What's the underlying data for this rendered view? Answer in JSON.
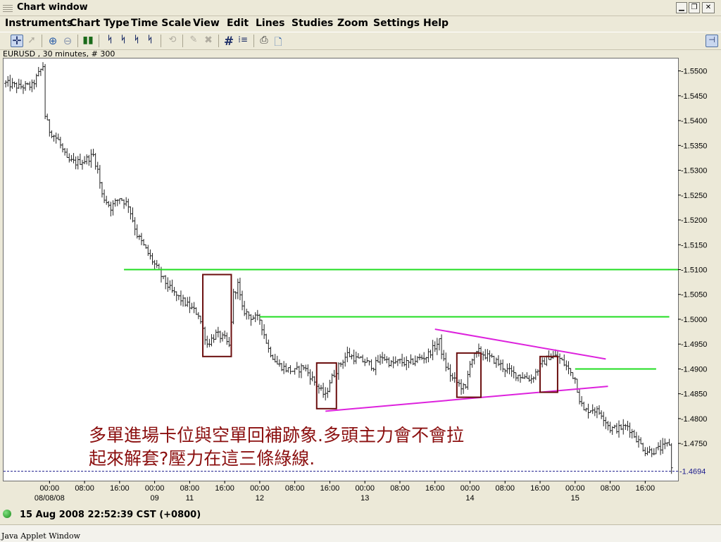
{
  "window": {
    "title": "Chart window",
    "minimize_icon": "minimize-icon",
    "restore_icon": "restore-icon",
    "close_icon": "close-icon"
  },
  "menu": [
    "Instruments",
    "Chart Type",
    "Time Scale",
    "View",
    "Edit",
    "Lines",
    "Studies",
    "Zoom",
    "Settings",
    "Help"
  ],
  "toolbar_icons": [
    "crosshair-icon",
    "pointer-icon",
    "zoom-in-icon",
    "zoom-out-icon",
    "bar-chart-icon",
    "candle-chart-icon",
    "line-chart-icon",
    "ohlc-chart-icon",
    "draw-line-icon",
    "erase-icon",
    "delete-icon",
    "grid-icon",
    "cursor-data-icon",
    "print-icon",
    "print-preview-icon",
    "pin-icon"
  ],
  "symbol_label": "EURUSD , 30 minutes, # 300",
  "status": {
    "datetime": "15 Aug 2008 22:52:39  CST (+0800)",
    "indicator_color": "#2ea82e"
  },
  "applet_label": "Java Applet Window",
  "annotation": {
    "line1": "多單進場卡位與空單回補跡象.多頭主力會不會拉",
    "line2": "起來解套?壓力在這三條綠線."
  },
  "chart_data": {
    "type": "ohlc",
    "symbol": "EURUSD",
    "interval": "30 minutes",
    "bars_count": 300,
    "ylim": [
      1.4675,
      1.5525
    ],
    "yticks": [
      "1.5500",
      "1.5450",
      "1.5400",
      "1.5350",
      "1.5300",
      "1.5250",
      "1.5200",
      "1.5150",
      "1.5100",
      "1.5050",
      "1.5000",
      "1.4950",
      "1.4900",
      "1.4850",
      "1.4800",
      "1.4750"
    ],
    "last_price": "1.4694",
    "x_ticks": [
      {
        "t": 0,
        "time": "00:00",
        "date": "08/08/08"
      },
      {
        "t": 8,
        "time": "08:00",
        "date": ""
      },
      {
        "t": 16,
        "time": "16:00",
        "date": ""
      },
      {
        "t": 24,
        "time": "00:00",
        "date": "09"
      },
      {
        "t": 32,
        "time": "08:00",
        "date": "11"
      },
      {
        "t": 40,
        "time": "16:00",
        "date": ""
      },
      {
        "t": 48,
        "time": "00:00",
        "date": "12"
      },
      {
        "t": 56,
        "time": "08:00",
        "date": ""
      },
      {
        "t": 64,
        "time": "16:00",
        "date": ""
      },
      {
        "t": 72,
        "time": "00:00",
        "date": "13"
      },
      {
        "t": 80,
        "time": "08:00",
        "date": ""
      },
      {
        "t": 88,
        "time": "16:00",
        "date": ""
      },
      {
        "t": 96,
        "time": "00:00",
        "date": "14"
      },
      {
        "t": 104,
        "time": "08:00",
        "date": ""
      },
      {
        "t": 112,
        "time": "16:00",
        "date": ""
      },
      {
        "t": 120,
        "time": "00:00",
        "date": "15"
      },
      {
        "t": 128,
        "time": "08:00",
        "date": ""
      },
      {
        "t": 136,
        "time": "16:00",
        "date": ""
      }
    ],
    "t_range": [
      -10.5,
      143.5
    ],
    "price_path": [
      [
        -10,
        1.5475
      ],
      [
        -7,
        1.5468
      ],
      [
        -4,
        1.547
      ],
      [
        -1.5,
        1.551
      ],
      [
        -1,
        1.541
      ],
      [
        0,
        1.538
      ],
      [
        2,
        1.536
      ],
      [
        4,
        1.532
      ],
      [
        6,
        1.5315
      ],
      [
        8,
        1.532
      ],
      [
        10,
        1.533
      ],
      [
        11,
        1.53
      ],
      [
        12,
        1.525
      ],
      [
        14,
        1.5225
      ],
      [
        16,
        1.5245
      ],
      [
        18,
        1.523
      ],
      [
        20,
        1.517
      ],
      [
        22,
        1.514
      ],
      [
        24,
        1.511
      ],
      [
        26,
        1.508
      ],
      [
        28,
        1.5055
      ],
      [
        30,
        1.504
      ],
      [
        32,
        1.5025
      ],
      [
        34,
        1.501
      ],
      [
        36,
        1.495
      ],
      [
        38,
        1.497
      ],
      [
        40,
        1.496
      ],
      [
        41,
        1.4945
      ],
      [
        42,
        1.505
      ],
      [
        43,
        1.507
      ],
      [
        44,
        1.502
      ],
      [
        46,
        1.5005
      ],
      [
        48,
        1.5
      ],
      [
        50,
        1.494
      ],
      [
        52,
        1.491
      ],
      [
        54,
        1.49
      ],
      [
        56,
        1.4895
      ],
      [
        58,
        1.4905
      ],
      [
        60,
        1.488
      ],
      [
        62,
        1.4855
      ],
      [
        63,
        1.4845
      ],
      [
        64,
        1.4875
      ],
      [
        66,
        1.4905
      ],
      [
        68,
        1.493
      ],
      [
        70,
        1.492
      ],
      [
        72,
        1.4915
      ],
      [
        74,
        1.4905
      ],
      [
        76,
        1.4925
      ],
      [
        78,
        1.491
      ],
      [
        80,
        1.4915
      ],
      [
        82,
        1.491
      ],
      [
        84,
        1.492
      ],
      [
        86,
        1.4925
      ],
      [
        88,
        1.4945
      ],
      [
        89,
        1.4955
      ],
      [
        90,
        1.4915
      ],
      [
        92,
        1.488
      ],
      [
        94,
        1.4865
      ],
      [
        95,
        1.486
      ],
      [
        96,
        1.4915
      ],
      [
        98,
        1.4935
      ],
      [
        100,
        1.4925
      ],
      [
        102,
        1.4915
      ],
      [
        104,
        1.49
      ],
      [
        106,
        1.489
      ],
      [
        108,
        1.4885
      ],
      [
        110,
        1.488
      ],
      [
        112,
        1.4905
      ],
      [
        114,
        1.4925
      ],
      [
        116,
        1.4925
      ],
      [
        118,
        1.4905
      ],
      [
        120,
        1.488
      ],
      [
        121,
        1.484
      ],
      [
        122,
        1.4815
      ],
      [
        124,
        1.482
      ],
      [
        126,
        1.481
      ],
      [
        128,
        1.478
      ],
      [
        130,
        1.478
      ],
      [
        132,
        1.4785
      ],
      [
        134,
        1.476
      ],
      [
        136,
        1.4735
      ],
      [
        138,
        1.4735
      ],
      [
        140,
        1.4742
      ],
      [
        141.5,
        1.475
      ],
      [
        142,
        1.47
      ]
    ],
    "horizontal_lines": [
      {
        "price": 1.51,
        "t_start": 17,
        "t_end": 143.5,
        "color": "#22dd22"
      },
      {
        "price": 1.5005,
        "t_start": 48,
        "t_end": 141.5,
        "color": "#22dd22"
      },
      {
        "price": 1.49,
        "t_start": 120,
        "t_end": 138.5,
        "color": "#22dd22"
      },
      {
        "price": 1.4694,
        "t_start": -10.5,
        "t_end": 143.5,
        "color": "#1a1a8c",
        "style": "dashed"
      }
    ],
    "trend_lines": [
      {
        "t1": 88,
        "p1": 1.498,
        "t2": 127,
        "p2": 1.492,
        "color": "#dd22dd"
      },
      {
        "t1": 63,
        "p1": 1.4815,
        "t2": 127.5,
        "p2": 1.4865,
        "color": "#dd22dd"
      }
    ],
    "boxes": [
      {
        "t1": 35,
        "t2": 41.5,
        "p_top": 1.509,
        "p_bottom": 1.4925,
        "color": "#6b0f0f"
      },
      {
        "t1": 61,
        "t2": 65.5,
        "p_top": 1.4912,
        "p_bottom": 1.482,
        "color": "#6b0f0f"
      },
      {
        "t1": 93,
        "t2": 98.5,
        "p_top": 1.4932,
        "p_bottom": 1.4843,
        "color": "#6b0f0f"
      },
      {
        "t1": 112,
        "t2": 116,
        "p_top": 1.4925,
        "p_bottom": 1.4853,
        "color": "#6b0f0f"
      }
    ]
  }
}
